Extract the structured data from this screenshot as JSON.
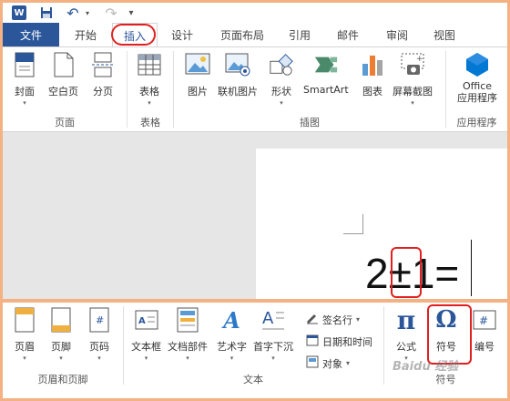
{
  "qat": {
    "word_logo": "W",
    "save": "💾",
    "undo": "↶",
    "undo_dd": "▾",
    "redo": "↷",
    "customize": "▾"
  },
  "tabs": {
    "file": "文件",
    "home": "开始",
    "insert": "插入",
    "design": "设计",
    "layout": "页面布局",
    "references": "引用",
    "mailings": "邮件",
    "review": "审阅",
    "view": "视图"
  },
  "ribbon": {
    "pages": {
      "label": "页面",
      "cover": "封面",
      "blank": "空白页",
      "break": "分页"
    },
    "table": {
      "label": "表格",
      "table": "表格"
    },
    "illustrations": {
      "label": "插图",
      "picture": "图片",
      "online_picture": "联机图片",
      "shapes": "形状",
      "smartart": "SmartArt",
      "chart": "图表",
      "screenshot": "屏幕截图"
    },
    "apps": {
      "label": "应用程序",
      "office_line1": "Office",
      "office_line2": "应用程序"
    }
  },
  "document": {
    "equation": "2±1="
  },
  "ribbon2": {
    "header_footer": {
      "label": "页眉和页脚",
      "header": "页眉",
      "footer": "页脚",
      "page_number": "页码"
    },
    "text": {
      "label": "文本",
      "textbox": "文本框",
      "quick_parts": "文档部件",
      "wordart": "艺术字",
      "dropcap": "首字下沉",
      "signature": "签名行",
      "datetime": "日期和时间",
      "object": "对象"
    },
    "symbols": {
      "label": "符号",
      "equation": "公式",
      "symbol": "符号",
      "number": "编号"
    }
  },
  "watermark": "Baidu 经验",
  "colors": {
    "accent": "#2b579a",
    "frame": "#f4b183",
    "highlight": "#e02020"
  },
  "icons": [
    "word-logo-icon",
    "save-icon",
    "undo-icon",
    "redo-icon",
    "cover-page-icon",
    "blank-page-icon",
    "page-break-icon",
    "table-icon",
    "picture-icon",
    "online-picture-icon",
    "shapes-icon",
    "smartart-icon",
    "chart-icon",
    "screenshot-icon",
    "office-apps-icon",
    "header-icon",
    "footer-icon",
    "page-number-icon",
    "textbox-icon",
    "quick-parts-icon",
    "wordart-icon",
    "dropcap-icon",
    "signature-line-icon",
    "datetime-icon",
    "object-icon",
    "equation-icon",
    "omega-symbol-icon",
    "number-icon"
  ]
}
